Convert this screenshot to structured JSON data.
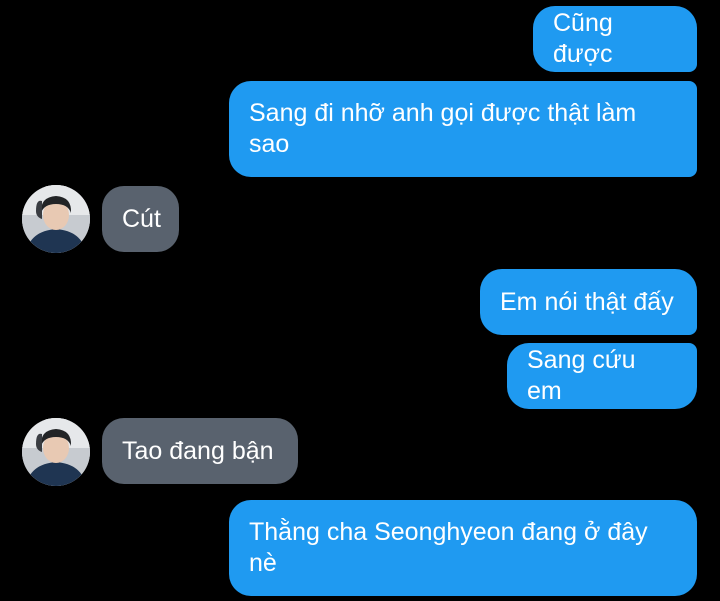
{
  "colors": {
    "background": "#000000",
    "outgoing_bubble": "#1f9af1",
    "incoming_bubble": "#59626e",
    "text": "#ffffff"
  },
  "messages": [
    {
      "sender": "me",
      "text": "Cũng được"
    },
    {
      "sender": "me",
      "text": "Sang đi nhỡ anh gọi được thật làm sao"
    },
    {
      "sender": "other",
      "text": "Cút",
      "avatar_icon": "user-avatar-photo"
    },
    {
      "sender": "me",
      "text": "Em nói thật đấy"
    },
    {
      "sender": "me",
      "text": "Sang cứu em"
    },
    {
      "sender": "other",
      "text": "Tao đang bận",
      "avatar_icon": "user-avatar-photo"
    },
    {
      "sender": "me",
      "text": "Thằng cha Seonghyeon đang ở đây nè"
    }
  ]
}
